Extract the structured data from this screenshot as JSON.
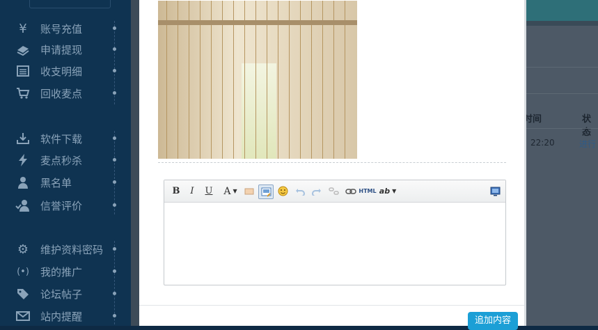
{
  "sidebar": {
    "groups": [
      [
        {
          "label": "账号充值",
          "icon": "yen-icon"
        },
        {
          "label": "申请提现",
          "icon": "money-stack-icon"
        },
        {
          "label": "收支明细",
          "icon": "calendar-list-icon"
        },
        {
          "label": "回收麦点",
          "icon": "cart-icon"
        }
      ],
      [
        {
          "label": "软件下载",
          "icon": "download-icon"
        },
        {
          "label": "麦点秒杀",
          "icon": "lightning-icon"
        },
        {
          "label": "黑名单",
          "icon": "user-block-icon"
        },
        {
          "label": "信誉评价",
          "icon": "user-check-icon"
        }
      ],
      [
        {
          "label": "维护资料密码",
          "icon": "gear-icon"
        },
        {
          "label": "我的推广",
          "icon": "broadcast-icon"
        },
        {
          "label": "论坛帖子",
          "icon": "tag-icon"
        },
        {
          "label": "站内提醒",
          "icon": "mail-icon"
        }
      ]
    ]
  },
  "background_table": {
    "headers": [
      "时间",
      "状态"
    ],
    "row": [
      "22:20",
      "进行"
    ]
  },
  "editor": {
    "toolbar": [
      {
        "name": "bold-button",
        "label": "B",
        "icon": "bold-icon"
      },
      {
        "name": "italic-button",
        "label": "I",
        "icon": "italic-icon"
      },
      {
        "name": "underline-button",
        "label": "U",
        "icon": "underline-icon"
      },
      {
        "name": "font-color-button",
        "label": "A",
        "icon": "font-color-icon"
      },
      {
        "name": "highlight-button",
        "icon": "highlight-icon"
      },
      {
        "name": "insert-image-button",
        "icon": "image-icon"
      },
      {
        "name": "emoticon-button",
        "icon": "smiley-icon"
      },
      {
        "name": "undo-button",
        "icon": "undo-icon"
      },
      {
        "name": "redo-button",
        "icon": "redo-icon"
      },
      {
        "name": "unlink-button",
        "icon": "unlink-icon"
      },
      {
        "name": "link-button",
        "icon": "link-icon"
      },
      {
        "name": "html-button",
        "label": "HTML",
        "icon": "html-icon"
      },
      {
        "name": "spellcheck-button",
        "label": "ab",
        "icon": "spellcheck-icon"
      },
      {
        "name": "fullscreen-button",
        "icon": "fullscreen-icon"
      }
    ]
  },
  "actions": {
    "append_label": "追加内容"
  },
  "colors": {
    "sidebar_bg": "#0f3351",
    "sidebar_text": "#8aa3b9",
    "primary_button": "#1b9fd6"
  }
}
